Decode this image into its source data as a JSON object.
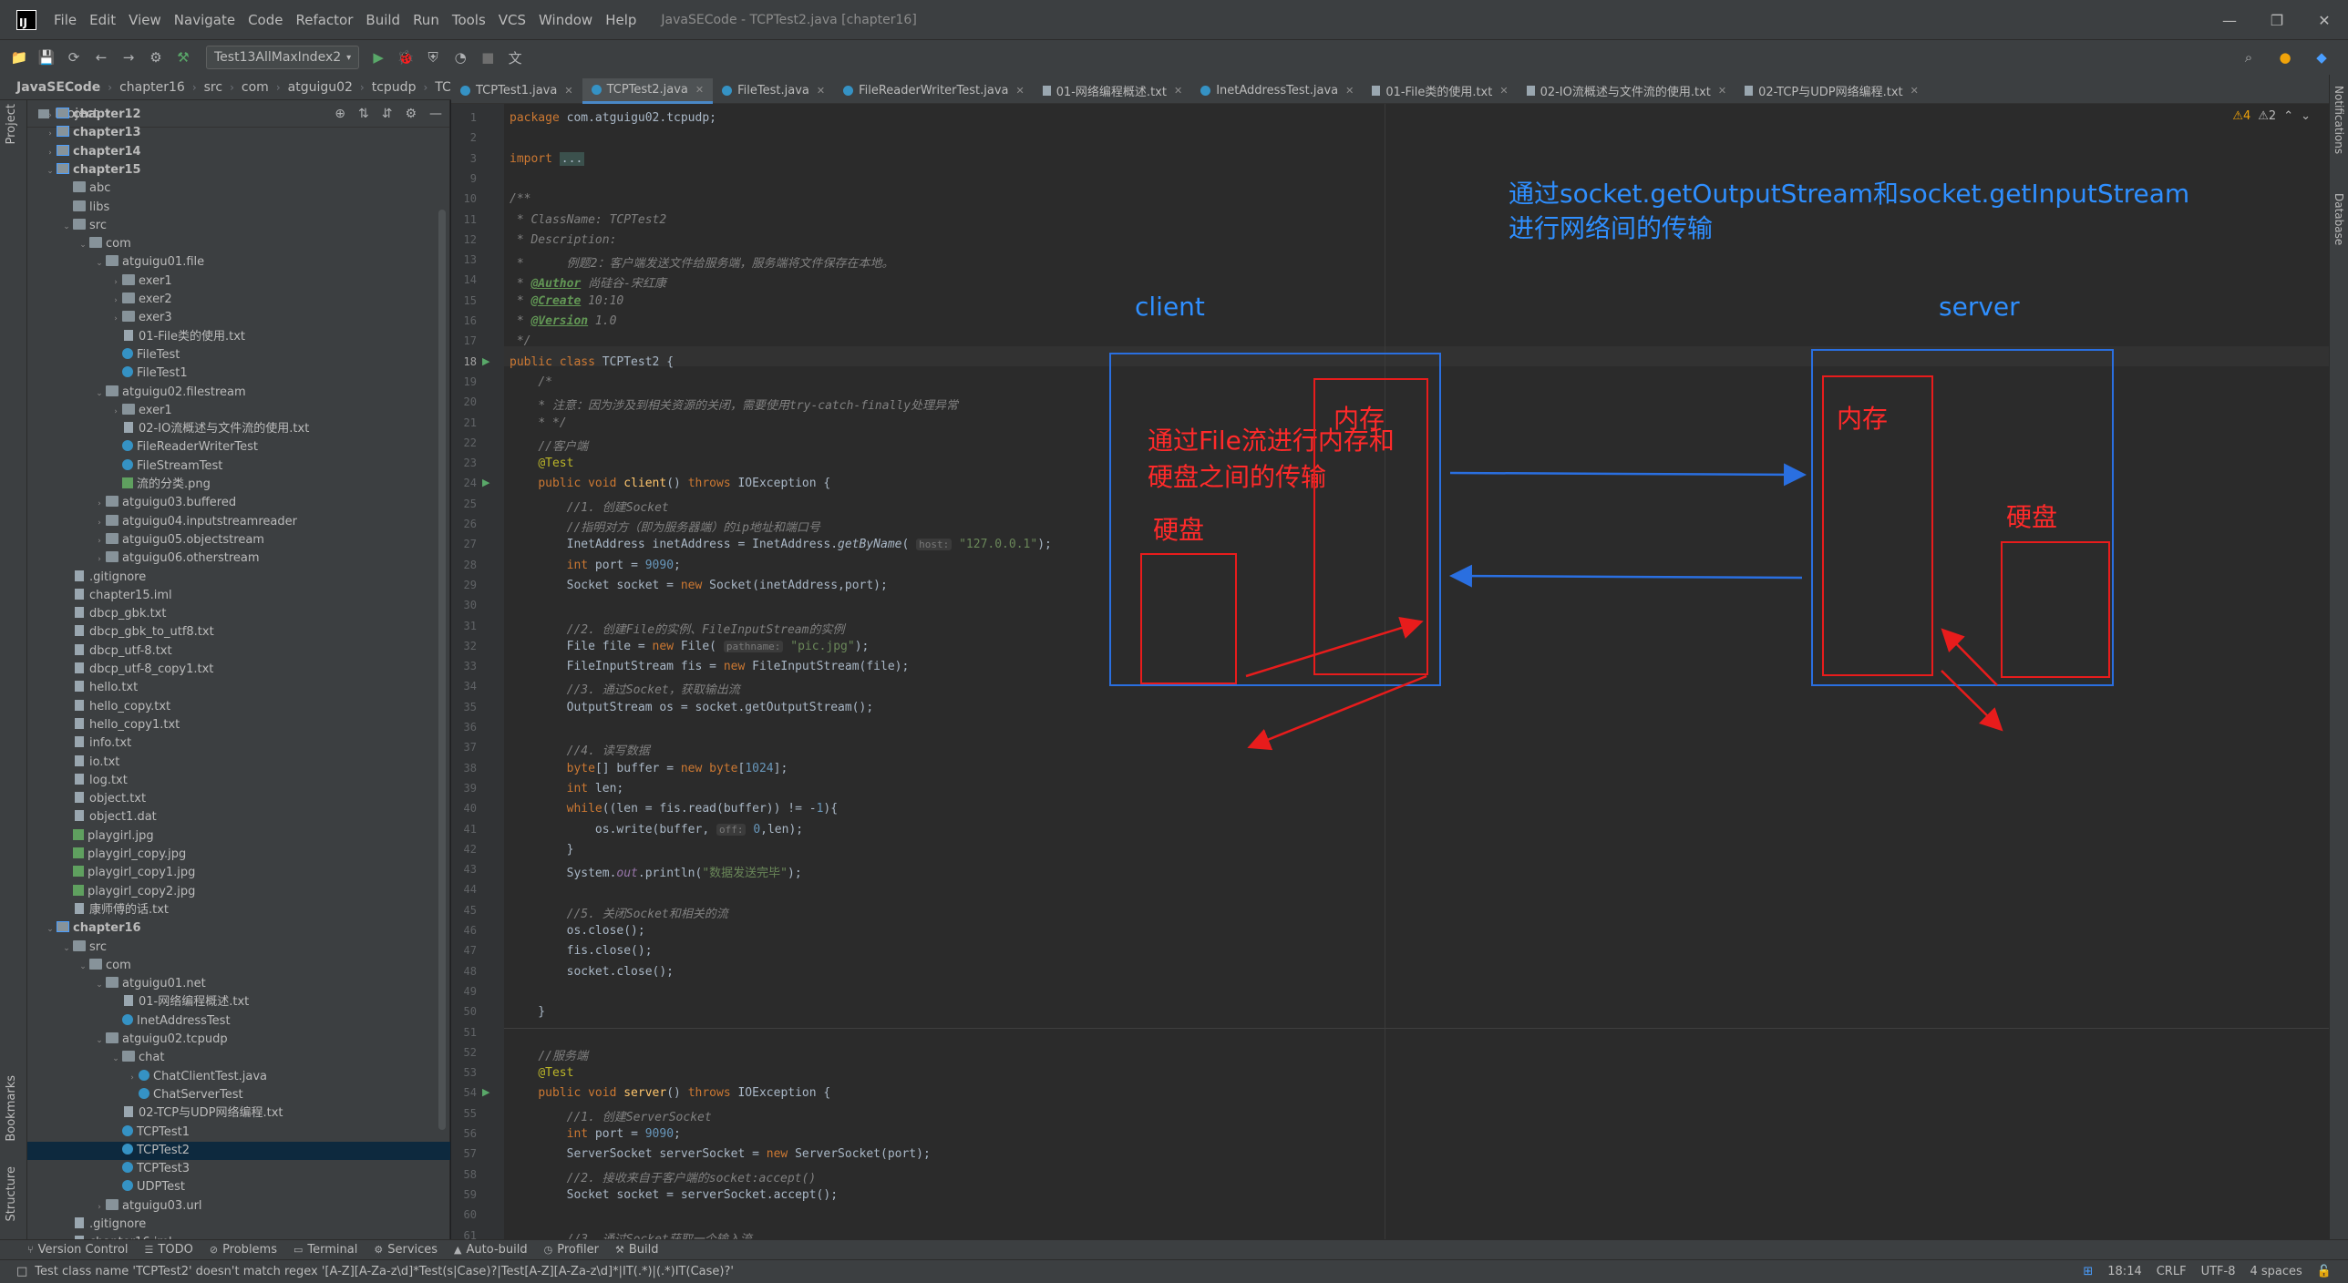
{
  "window": {
    "title": "JavaSECode - TCPTest2.java [chapter16]",
    "menu": [
      "File",
      "Edit",
      "View",
      "Navigate",
      "Code",
      "Refactor",
      "Build",
      "Run",
      "Tools",
      "VCS",
      "Window",
      "Help"
    ],
    "controls": {
      "minimize": "—",
      "maximize": "❐",
      "close": "✕"
    }
  },
  "toolbar": {
    "run_config": "Test13AllMaxIndex2"
  },
  "breadcrumb": [
    "JavaSECode",
    "chapter16",
    "src",
    "com",
    "atguigu02",
    "tcpudp",
    "TCPTest2"
  ],
  "left_stripe": {
    "project": "Project",
    "bookmarks": "Bookmarks",
    "structure": "Structure"
  },
  "right_stripe": {
    "notifications": "Notifications",
    "database": "Database"
  },
  "project_panel": {
    "title": "Project",
    "tree": [
      {
        "label": "chapter12",
        "depth": 1,
        "kind": "module",
        "arrow": "›",
        "bold": true
      },
      {
        "label": "chapter13",
        "depth": 1,
        "kind": "module",
        "arrow": "›",
        "bold": true
      },
      {
        "label": "chapter14",
        "depth": 1,
        "kind": "module",
        "arrow": "›",
        "bold": true
      },
      {
        "label": "chapter15",
        "depth": 1,
        "kind": "module",
        "arrow": "⌄",
        "bold": true
      },
      {
        "label": "abc",
        "depth": 2,
        "kind": "folder",
        "arrow": ""
      },
      {
        "label": "libs",
        "depth": 2,
        "kind": "folder",
        "arrow": ""
      },
      {
        "label": "src",
        "depth": 2,
        "kind": "folder",
        "arrow": "⌄"
      },
      {
        "label": "com",
        "depth": 3,
        "kind": "pkg",
        "arrow": "⌄"
      },
      {
        "label": "atguigu01.file",
        "depth": 4,
        "kind": "pkg",
        "arrow": "⌄"
      },
      {
        "label": "exer1",
        "depth": 5,
        "kind": "pkg",
        "arrow": "›"
      },
      {
        "label": "exer2",
        "depth": 5,
        "kind": "pkg",
        "arrow": "›"
      },
      {
        "label": "exer3",
        "depth": 5,
        "kind": "pkg",
        "arrow": "›"
      },
      {
        "label": "01-File类的使用.txt",
        "depth": 5,
        "kind": "file",
        "arrow": ""
      },
      {
        "label": "FileTest",
        "depth": 5,
        "kind": "java",
        "arrow": ""
      },
      {
        "label": "FileTest1",
        "depth": 5,
        "kind": "java",
        "arrow": ""
      },
      {
        "label": "atguigu02.filestream",
        "depth": 4,
        "kind": "pkg",
        "arrow": "⌄"
      },
      {
        "label": "exer1",
        "depth": 5,
        "kind": "pkg",
        "arrow": "›"
      },
      {
        "label": "02-IO流概述与文件流的使用.txt",
        "depth": 5,
        "kind": "file",
        "arrow": ""
      },
      {
        "label": "FileReaderWriterTest",
        "depth": 5,
        "kind": "java",
        "arrow": ""
      },
      {
        "label": "FileStreamTest",
        "depth": 5,
        "kind": "java",
        "arrow": ""
      },
      {
        "label": "流的分类.png",
        "depth": 5,
        "kind": "img",
        "arrow": ""
      },
      {
        "label": "atguigu03.buffered",
        "depth": 4,
        "kind": "pkg",
        "arrow": "›"
      },
      {
        "label": "atguigu04.inputstreamreader",
        "depth": 4,
        "kind": "pkg",
        "arrow": "›"
      },
      {
        "label": "atguigu05.objectstream",
        "depth": 4,
        "kind": "pkg",
        "arrow": "›"
      },
      {
        "label": "atguigu06.otherstream",
        "depth": 4,
        "kind": "pkg",
        "arrow": "›"
      },
      {
        "label": ".gitignore",
        "depth": 2,
        "kind": "file",
        "arrow": ""
      },
      {
        "label": "chapter15.iml",
        "depth": 2,
        "kind": "file",
        "arrow": ""
      },
      {
        "label": "dbcp_gbk.txt",
        "depth": 2,
        "kind": "file",
        "arrow": ""
      },
      {
        "label": "dbcp_gbk_to_utf8.txt",
        "depth": 2,
        "kind": "file",
        "arrow": ""
      },
      {
        "label": "dbcp_utf-8.txt",
        "depth": 2,
        "kind": "file",
        "arrow": ""
      },
      {
        "label": "dbcp_utf-8_copy1.txt",
        "depth": 2,
        "kind": "file",
        "arrow": ""
      },
      {
        "label": "hello.txt",
        "depth": 2,
        "kind": "file",
        "arrow": ""
      },
      {
        "label": "hello_copy.txt",
        "depth": 2,
        "kind": "file",
        "arrow": ""
      },
      {
        "label": "hello_copy1.txt",
        "depth": 2,
        "kind": "file",
        "arrow": ""
      },
      {
        "label": "info.txt",
        "depth": 2,
        "kind": "file",
        "arrow": ""
      },
      {
        "label": "io.txt",
        "depth": 2,
        "kind": "file",
        "arrow": ""
      },
      {
        "label": "log.txt",
        "depth": 2,
        "kind": "file",
        "arrow": ""
      },
      {
        "label": "object.txt",
        "depth": 2,
        "kind": "file",
        "arrow": ""
      },
      {
        "label": "object1.dat",
        "depth": 2,
        "kind": "file",
        "arrow": ""
      },
      {
        "label": "playgirl.jpg",
        "depth": 2,
        "kind": "img",
        "arrow": ""
      },
      {
        "label": "playgirl_copy.jpg",
        "depth": 2,
        "kind": "img",
        "arrow": ""
      },
      {
        "label": "playgirl_copy1.jpg",
        "depth": 2,
        "kind": "img",
        "arrow": ""
      },
      {
        "label": "playgirl_copy2.jpg",
        "depth": 2,
        "kind": "img",
        "arrow": ""
      },
      {
        "label": "康师傅的话.txt",
        "depth": 2,
        "kind": "file",
        "arrow": ""
      },
      {
        "label": "chapter16",
        "depth": 1,
        "kind": "module",
        "arrow": "⌄",
        "bold": true
      },
      {
        "label": "src",
        "depth": 2,
        "kind": "folder",
        "arrow": "⌄"
      },
      {
        "label": "com",
        "depth": 3,
        "kind": "pkg",
        "arrow": "⌄"
      },
      {
        "label": "atguigu01.net",
        "depth": 4,
        "kind": "pkg",
        "arrow": "⌄"
      },
      {
        "label": "01-网络编程概述.txt",
        "depth": 5,
        "kind": "file",
        "arrow": ""
      },
      {
        "label": "InetAddressTest",
        "depth": 5,
        "kind": "java",
        "arrow": ""
      },
      {
        "label": "atguigu02.tcpudp",
        "depth": 4,
        "kind": "pkg",
        "arrow": "⌄"
      },
      {
        "label": "chat",
        "depth": 5,
        "kind": "pkg",
        "arrow": "⌄"
      },
      {
        "label": "ChatClientTest.java",
        "depth": 6,
        "kind": "java",
        "arrow": "›"
      },
      {
        "label": "ChatServerTest",
        "depth": 6,
        "kind": "java",
        "arrow": ""
      },
      {
        "label": "02-TCP与UDP网络编程.txt",
        "depth": 5,
        "kind": "file",
        "arrow": ""
      },
      {
        "label": "TCPTest1",
        "depth": 5,
        "kind": "java",
        "arrow": ""
      },
      {
        "label": "TCPTest2",
        "depth": 5,
        "kind": "java",
        "arrow": "",
        "selected": true
      },
      {
        "label": "TCPTest3",
        "depth": 5,
        "kind": "java",
        "arrow": ""
      },
      {
        "label": "UDPTest",
        "depth": 5,
        "kind": "java",
        "arrow": ""
      },
      {
        "label": "atguigu03.url",
        "depth": 4,
        "kind": "pkg",
        "arrow": "›"
      },
      {
        "label": ".gitignore",
        "depth": 2,
        "kind": "file",
        "arrow": ""
      },
      {
        "label": "chapter16.iml",
        "depth": 2,
        "kind": "file",
        "arrow": ""
      }
    ]
  },
  "editor_tabs": [
    {
      "label": "TCPTest1.java",
      "type": "java"
    },
    {
      "label": "TCPTest2.java",
      "type": "java",
      "active": true
    },
    {
      "label": "FileTest.java",
      "type": "java"
    },
    {
      "label": "FileReaderWriterTest.java",
      "type": "java"
    },
    {
      "label": "01-网络编程概述.txt",
      "type": "txt"
    },
    {
      "label": "InetAddressTest.java",
      "type": "java"
    },
    {
      "label": "01-File类的使用.txt",
      "type": "txt"
    },
    {
      "label": "02-IO流概述与文件流的使用.txt",
      "type": "txt"
    },
    {
      "label": "02-TCP与UDP网络编程.txt",
      "type": "txt"
    }
  ],
  "editor": {
    "warnings": "⚠4",
    "weak_warnings": "⚠2",
    "current_line": 18,
    "line_numbers": [
      1,
      2,
      3,
      9,
      10,
      11,
      12,
      13,
      14,
      15,
      16,
      17,
      18,
      19,
      20,
      21,
      22,
      23,
      24,
      25,
      26,
      27,
      28,
      29,
      30,
      31,
      32,
      33,
      34,
      35,
      36,
      37,
      38,
      39,
      40,
      41,
      42,
      43,
      44,
      45,
      46,
      47,
      48,
      49,
      50,
      51,
      52,
      53,
      54,
      55,
      56,
      57,
      58,
      59,
      60,
      61,
      62
    ],
    "lines": [
      "<span class=\"kw\">package</span> com.atguigu02.tcpudp;",
      "",
      "<span class=\"kw\">import</span> <span class=\"fold\">...</span>",
      "",
      "<span class=\"cm\">/**</span>",
      "<span class=\"cm\"> * ClassName: TCPTest2</span>",
      "<span class=\"cm\"> * Description:</span>",
      "<span class=\"cm\"> *      例题2：客户端发送文件给服务端，服务端将文件保存在本地。</span>",
      "<span class=\"cm\"> * </span><span class=\"dtag\">@Author</span><span class=\"cm\"> 尚硅谷-宋红康</span>",
      "<span class=\"cm\"> * </span><span class=\"dtag\">@Create</span><span class=\"cm\"> 10:10</span>",
      "<span class=\"cm\"> * </span><span class=\"dtag\">@Version</span><span class=\"cm\"> 1.0</span>",
      "<span class=\"cm\"> */</span>",
      "<span class=\"kw\">public class</span> TCPTest2 {",
      "    <span class=\"cm\">/*</span>",
      "    <span class=\"cm\">* 注意：因为涉及到相关资源的关闭，需要使用try-catch-finally处理异常</span>",
      "    <span class=\"cm\">* */</span>",
      "    <span class=\"cm\">//客户端</span>",
      "    <span class=\"ann\">@Test</span>",
      "    <span class=\"kw\">public void</span> <span class=\"fn\">client</span>() <span class=\"kw\">throws</span> IOException {",
      "        <span class=\"cm\">//1. 创建Socket</span>",
      "        <span class=\"cm\">//指明对方（即为服务器端）的ip地址和端口号</span>",
      "        InetAddress inetAddress = InetAddress.<i>getByName</i>( <span class=\"hint\">host:</span> <span class=\"str\">\"127.0.0.1\"</span>);",
      "        <span class=\"kw\">int</span> port = <span class=\"num\">9090</span>;",
      "        Socket socket = <span class=\"kw\">new</span> Socket(inetAddress,port);",
      "",
      "        <span class=\"cm\">//2. 创建File的实例、FileInputStream的实例</span>",
      "        File file = <span class=\"kw\">new</span> File( <span class=\"hint\">pathname:</span> <span class=\"str\">\"pic.jpg\"</span>);",
      "        FileInputStream fis = <span class=\"kw\">new</span> FileInputStream(file);",
      "        <span class=\"cm\">//3. 通过Socket，获取输出流</span>",
      "        OutputStream os = socket.getOutputStream();",
      "",
      "        <span class=\"cm\">//4. 读写数据</span>",
      "        <span class=\"kw\">byte</span>[] buffer = <span class=\"kw\">new byte</span>[<span class=\"num\">1024</span>];",
      "        <span class=\"kw\">int</span> len;",
      "        <span class=\"kw\">while</span>((len = fis.read(buffer)) != -<span class=\"num\">1</span>){",
      "            os.write(buffer, <span class=\"hint\">off:</span> <span class=\"num\">0</span>,len);",
      "        }",
      "        System.<span class=\"field\">out</span>.println(<span class=\"str\">\"数据发送完毕\"</span>);",
      "",
      "        <span class=\"cm\">//5. 关闭Socket和相关的流</span>",
      "        os.close();",
      "        fis.close();",
      "        socket.close();",
      "",
      "    }",
      "",
      "    <span class=\"cm\">//服务端</span>",
      "    <span class=\"ann\">@Test</span>",
      "    <span class=\"kw\">public void</span> <span class=\"fn\">server</span>() <span class=\"kw\">throws</span> IOException {",
      "        <span class=\"cm\">//1. 创建ServerSocket</span>",
      "        <span class=\"kw\">int</span> port = <span class=\"num\">9090</span>;",
      "        ServerSocket serverSocket = <span class=\"kw\">new</span> ServerSocket(port);",
      "        <span class=\"cm\">//2. 接收来自于客户端的socket:accept()</span>",
      "        Socket socket = serverSocket.accept();",
      "",
      "        <span class=\"cm\">//3. 通过Socket获取一个输入流</span>",
      ""
    ]
  },
  "annotations": {
    "title_line1": "通过socket.getOutputStream和socket.getInputStream",
    "title_line2": "进行网络间的传输",
    "client": "client",
    "server": "server",
    "file_stream_line1": "通过File流进行内存和",
    "file_stream_line2": "硬盘之间的传输",
    "memory": "内存",
    "disk": "硬盘"
  },
  "bottom_tools": [
    "Version Control",
    "TODO",
    "Problems",
    "Terminal",
    "Services",
    "Auto-build",
    "Profiler",
    "Build"
  ],
  "status": {
    "message": "Test class name 'TCPTest2' doesn't match regex '[A-Z][A-Za-z\\d]*Test(s|Case)?|Test[A-Z][A-Za-z\\d]*|IT(.*)|(.*)IT(Case)?'",
    "position": "18:14",
    "line_sep": "CRLF",
    "encoding": "UTF-8",
    "indent": "4 spaces"
  },
  "colors": {
    "annotation_blue": "#2f8fff",
    "annotation_red": "#ff2a2a",
    "selection": "#0d293e"
  }
}
